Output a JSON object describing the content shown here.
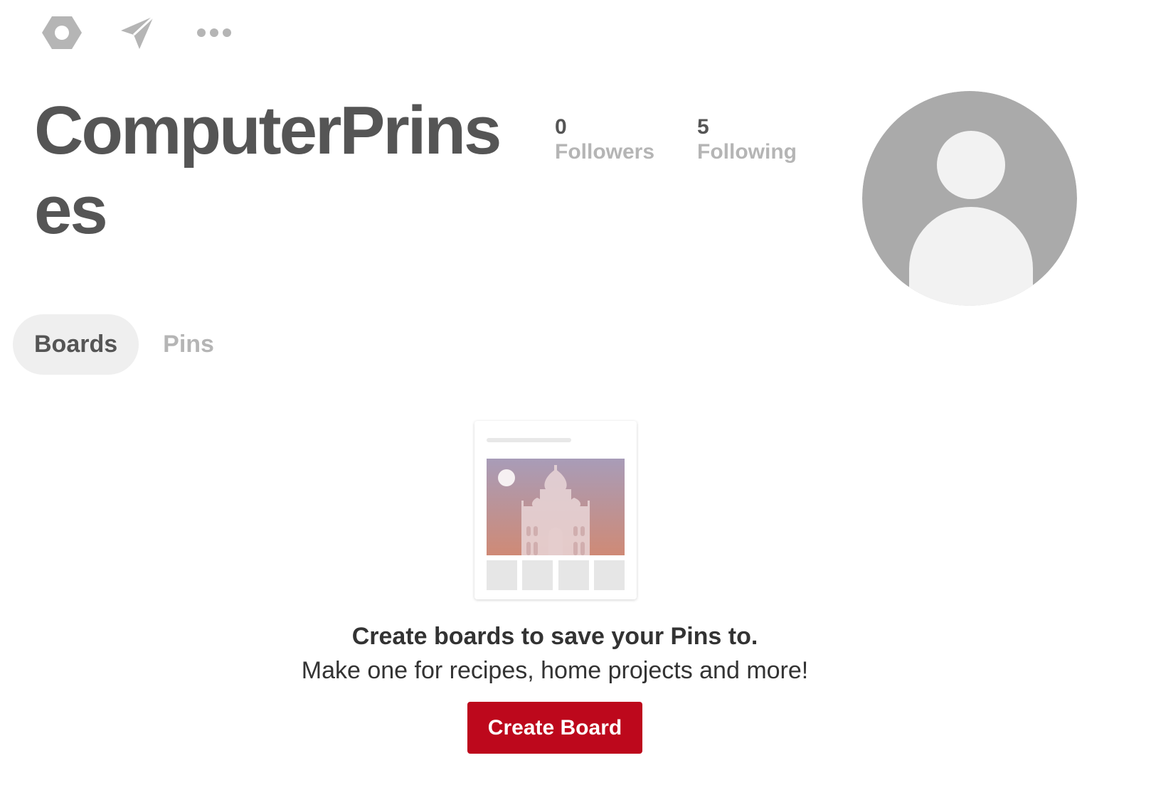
{
  "toolbar": {
    "icons": [
      "settings-icon",
      "send-icon",
      "more-icon"
    ]
  },
  "profile": {
    "name": "ComputerPrinses",
    "followers": {
      "count": "0",
      "label": "Followers"
    },
    "following": {
      "count": "5",
      "label": "Following"
    }
  },
  "tabs": {
    "boards": "Boards",
    "pins": "Pins",
    "active": "Boards"
  },
  "empty_state": {
    "title": "Create boards to save your Pins to.",
    "subtitle": "Make one for recipes, home projects and more!",
    "button": "Create Board"
  },
  "colors": {
    "primary_text": "#555555",
    "muted_text": "#b5b5b5",
    "button_red": "#bd081c",
    "avatar_bg": "#aaaaaa"
  }
}
